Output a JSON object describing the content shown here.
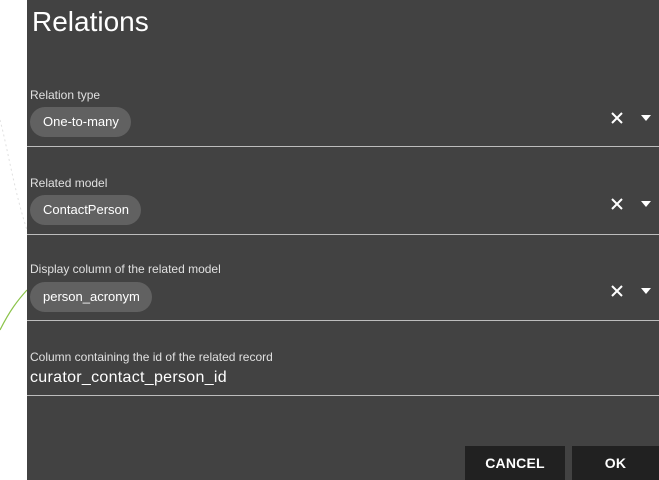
{
  "dialog": {
    "title": "Relations"
  },
  "fields": [
    {
      "label": "Relation type",
      "value": "One-to-many",
      "kind": "select"
    },
    {
      "label": "Related model",
      "value": "ContactPerson",
      "kind": "select"
    },
    {
      "label": "Display column of the related model",
      "value": "person_acronym",
      "kind": "select"
    },
    {
      "label": "Column containing the id of the related record",
      "value": "curator_contact_person_id",
      "kind": "text"
    }
  ],
  "actions": {
    "cancel_label": "CANCEL",
    "ok_label": "OK"
  },
  "icons": {
    "clear": "close-icon",
    "dropdown": "caret-down-icon"
  },
  "colors": {
    "dialog_bg": "#424242",
    "chip_bg": "#616161",
    "button_bg": "#212121",
    "underline": "#bdbdbd",
    "text": "#ffffff"
  }
}
